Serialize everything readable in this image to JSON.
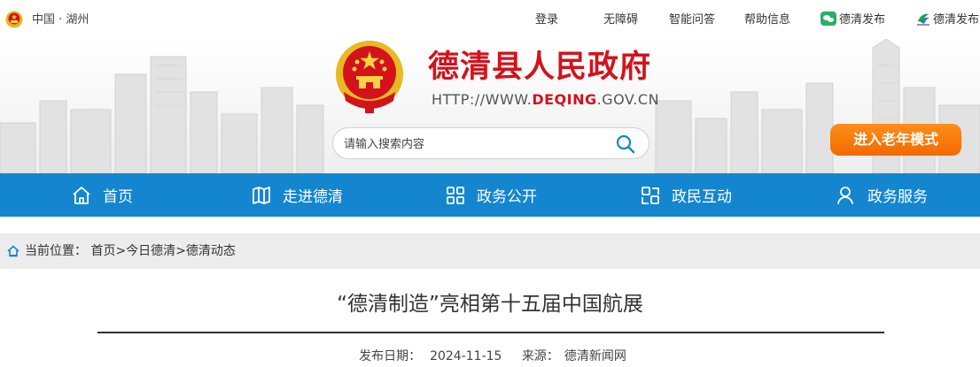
{
  "topbar": {
    "region": "中国 · 湖州",
    "links": [
      "登录",
      "无障碍",
      "智能问答",
      "帮助信息"
    ],
    "wechat_label": "德清发布",
    "app_label": "德清发布"
  },
  "header": {
    "site_title": "德清县人民政府",
    "url_prefix": "HTTP://WWW.",
    "url_domain": "DEQING",
    "url_suffix": ".GOV.CN",
    "search_placeholder": "请输入搜索内容",
    "elder_mode_label": "进入老年模式"
  },
  "nav": {
    "items": [
      {
        "label": "首页",
        "icon": "home-icon"
      },
      {
        "label": "走进德清",
        "icon": "map-icon"
      },
      {
        "label": "政务公开",
        "icon": "grid-icon"
      },
      {
        "label": "政民互动",
        "icon": "interaction-icon"
      },
      {
        "label": "政务服务",
        "icon": "user-icon"
      }
    ]
  },
  "breadcrumb": {
    "prefix": "当前位置：",
    "items": [
      "首页",
      "今日德清",
      "德清动态"
    ],
    "separator": ">"
  },
  "article": {
    "title": "“德清制造”亮相第十五届中国航展",
    "date_label": "发布日期：",
    "date": "2024-11-15",
    "source_label": "来源：",
    "source": "德清新闻网"
  },
  "colors": {
    "nav_blue": "#1486cf",
    "title_red": "#d4121c",
    "elder_orange": "#f57a0a"
  }
}
